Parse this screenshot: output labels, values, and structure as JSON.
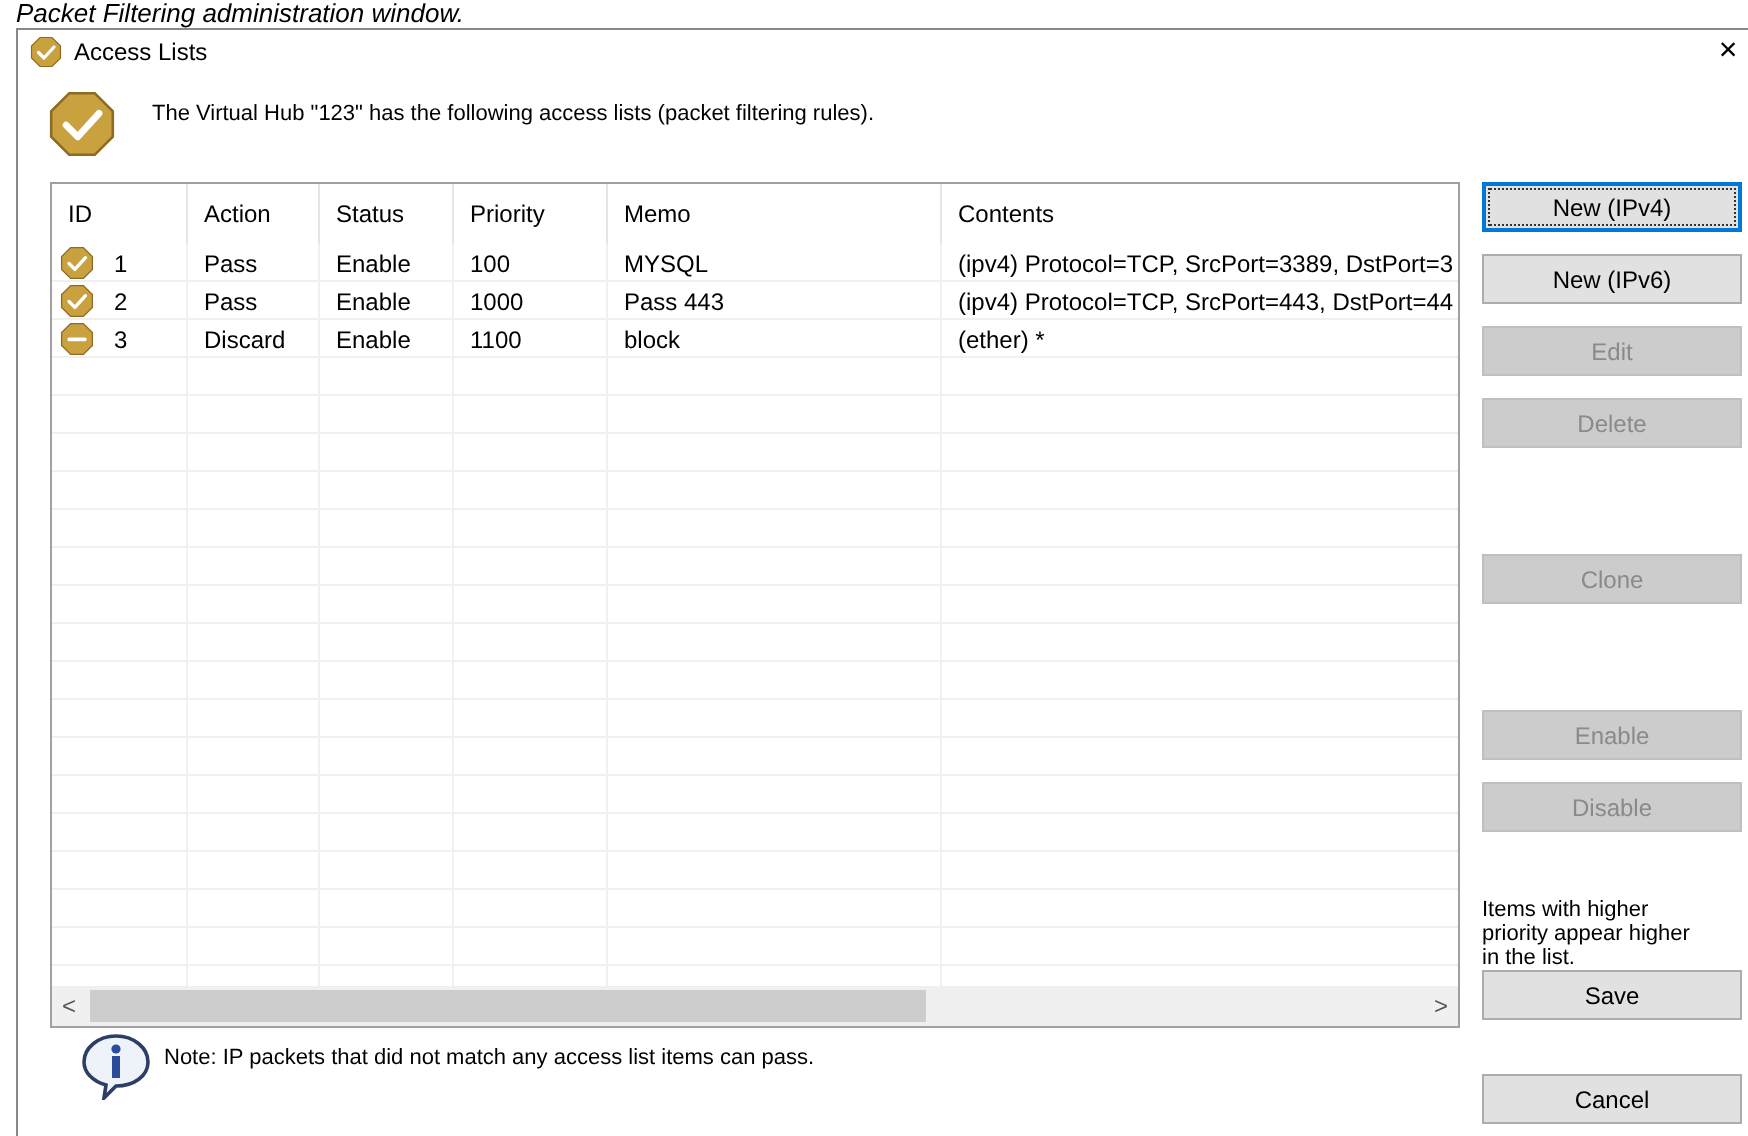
{
  "caption": "Packet Filtering administration window.",
  "window": {
    "title": "Access Lists",
    "close": "×"
  },
  "header": {
    "text": "The Virtual Hub \"123\" has the following access lists (packet filtering rules)."
  },
  "table": {
    "columns": [
      "ID",
      "Action",
      "Status",
      "Priority",
      "Memo",
      "Contents"
    ],
    "rows": [
      {
        "kind": "pass",
        "cells": [
          "1",
          "Pass",
          "Enable",
          "100",
          "MYSQL",
          "(ipv4) Protocol=TCP, SrcPort=3389, DstPort=3"
        ]
      },
      {
        "kind": "pass",
        "cells": [
          "2",
          "Pass",
          "Enable",
          "1000",
          "Pass 443",
          "(ipv4) Protocol=TCP, SrcPort=443, DstPort=44"
        ]
      },
      {
        "kind": "discard",
        "cells": [
          "3",
          "Discard",
          "Enable",
          "1100",
          "block",
          "(ether) *"
        ]
      }
    ],
    "scroll_left": "<",
    "scroll_right": ">"
  },
  "button_groups": [
    [
      {
        "label": "New (IPv4)",
        "disabled": false,
        "focused": true
      },
      {
        "label": "New (IPv6)",
        "disabled": false,
        "focused": false
      },
      {
        "label": "Edit",
        "disabled": true,
        "focused": false
      },
      {
        "label": "Delete",
        "disabled": true,
        "focused": false
      }
    ],
    [
      {
        "label": "Clone",
        "disabled": true,
        "focused": false
      }
    ],
    [
      {
        "label": "Enable",
        "disabled": true,
        "focused": false
      },
      {
        "label": "Disable",
        "disabled": true,
        "focused": false
      }
    ]
  ],
  "hint": "Items with higher priority appear higher in the list.",
  "dialog_buttons": [
    {
      "label": "Save",
      "disabled": false
    },
    {
      "label": "Cancel",
      "disabled": false
    }
  ],
  "note": "Note: IP packets that did not match any access list items can pass."
}
